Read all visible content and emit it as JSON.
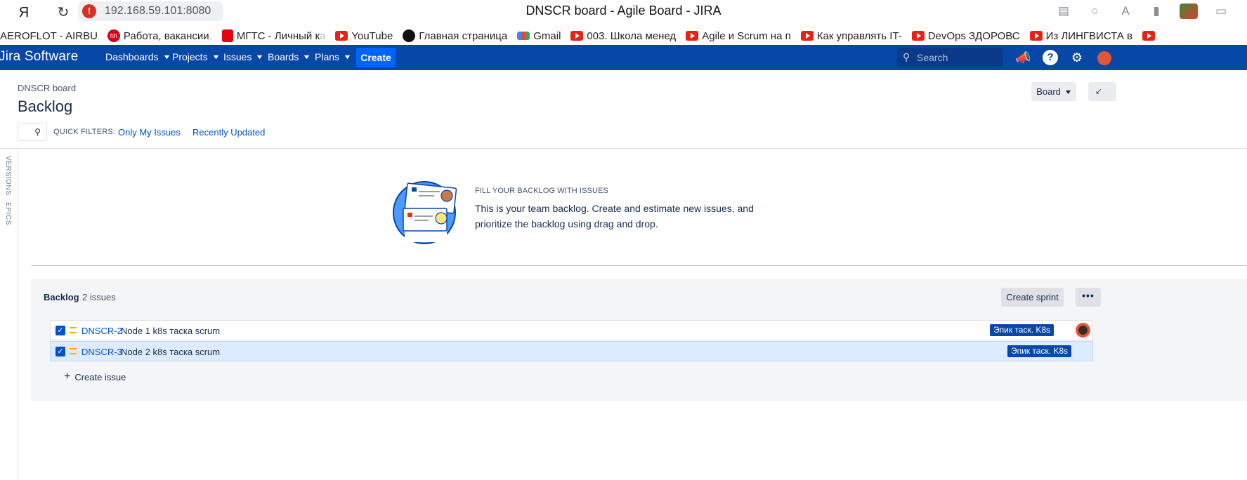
{
  "browser": {
    "address": "192.168.59.101:8080",
    "tab_title": "DNSCR board - Agile Board - JIRA",
    "bookmarks": [
      {
        "label": "AEROFLOT - AIRBU",
        "icon": "none",
        "fade": ""
      },
      {
        "label": "Работа, вакансии",
        "icon": "hh-icon",
        "fade": ","
      },
      {
        "label": "МГТС - Личный к",
        "icon": "mgts-icon",
        "fade": "а"
      },
      {
        "label": "YouTube",
        "icon": "youtube-icon",
        "fade": ""
      },
      {
        "label": "Главная страница",
        "icon": "star-icon",
        "fade": ""
      },
      {
        "label": "Gmail",
        "icon": "gmail-icon",
        "fade": ""
      },
      {
        "label": "003. Школа менед",
        "icon": "youtube-icon",
        "fade": ""
      },
      {
        "label": "Agile и Scrum на п",
        "icon": "youtube-icon",
        "fade": ""
      },
      {
        "label": "Как управлять IT-",
        "icon": "youtube-icon",
        "fade": ""
      },
      {
        "label": "DevOps ЗДОРОВС",
        "icon": "youtube-icon",
        "fade": ""
      },
      {
        "label": "Из ЛИНГВИСТА в",
        "icon": "youtube-icon",
        "fade": ""
      }
    ]
  },
  "jira": {
    "logo": "Jira Software",
    "nav": [
      "Dashboards",
      "Projects",
      "Issues",
      "Boards",
      "Plans"
    ],
    "create_label": "Create",
    "search_placeholder": "Search"
  },
  "board": {
    "breadcrumb": "DNSCR board",
    "title": "Backlog",
    "board_button": "Board",
    "quick_filters_label": "QUICK FILTERS:",
    "quick_filters": [
      "Only My Issues",
      "Recently Updated"
    ],
    "side_tabs": [
      "VERSIONS",
      "EPICS"
    ]
  },
  "empty_state": {
    "heading": "FILL YOUR BACKLOG WITH ISSUES",
    "body": "This is your team backlog. Create and estimate new issues, and prioritize the backlog using drag and drop."
  },
  "backlog": {
    "title": "Backlog",
    "count": "2 issues",
    "create_sprint": "Create sprint",
    "more": "•••",
    "create_issue": "Create issue",
    "issues": [
      {
        "key": "DNSCR-2",
        "summary": "Node 1 k8s таска scrum",
        "epic": "Эпик таск. K8s",
        "has_assignee": true
      },
      {
        "key": "DNSCR-3",
        "summary": "Node 2 k8s таска scrum",
        "epic": "Эпик таск. K8s",
        "has_assignee": false
      }
    ]
  },
  "colors": {
    "header": "#0747a6",
    "create_button": "#0065ff",
    "link": "#0052cc",
    "epic": "#0747a6",
    "selected_row": "#deebff"
  }
}
